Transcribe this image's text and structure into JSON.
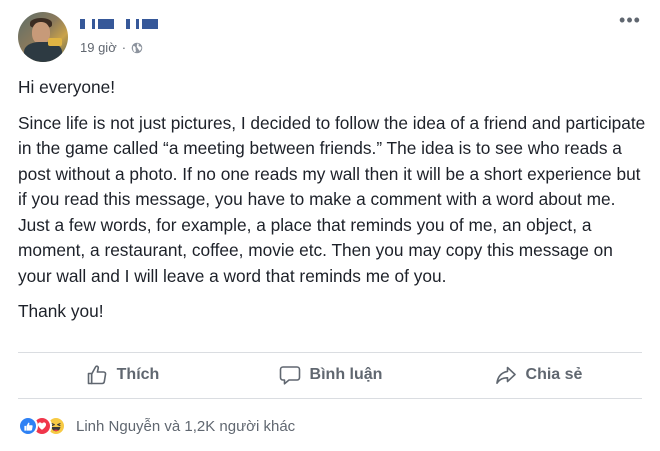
{
  "post": {
    "time": "19 giờ",
    "separator": "·",
    "more_label": "•••",
    "paragraphs": [
      "Hi everyone!",
      "Since life is not just pictures, I decided to follow the idea of a friend and participate in the game called “a meeting between friends.” The idea is to see who reads a post without a photo. If no one reads my wall then it will be a short experience but if you read this message, you have to make a comment with a word about me. Just a few words, for example, a place that reminds you of me, an object, a moment, a restaurant, coffee, movie etc. Then you may copy this message on your wall and I will leave a word that reminds me of you.",
      "Thank you!"
    ]
  },
  "actions": {
    "like_label": "Thích",
    "comment_label": "Bình luận",
    "share_label": "Chia sẻ"
  },
  "reactions": {
    "summary": "Linh Nguyễn và 1,2K người khác",
    "icons": [
      "like-icon",
      "love-icon",
      "haha-icon"
    ]
  },
  "colors": {
    "name_redacted": "#365899",
    "text": "#1d2129",
    "muted": "#606770",
    "like": "#2e81f4",
    "love": "#f0364b",
    "haha": "#f7ca44"
  }
}
